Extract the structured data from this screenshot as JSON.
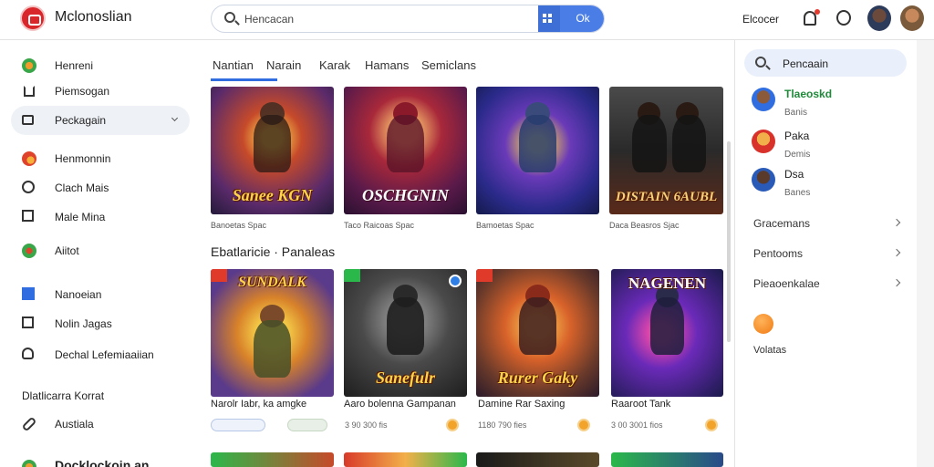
{
  "header": {
    "app_name": "Mclonoslian",
    "search_placeholder": "Hencacan",
    "search_button_label": "Ok",
    "right_text": "Elcocer",
    "bell_dot_color": "#e43b2f"
  },
  "sidebar": {
    "items": [
      {
        "label": "Henreni",
        "icon": "globe-icon"
      },
      {
        "label": "Piemsogan",
        "icon": "home-icon"
      },
      {
        "label": "Peckagain",
        "icon": "library-icon",
        "active": true
      },
      {
        "label": "Henmonnin",
        "icon": "flame-icon"
      },
      {
        "label": "Clach Mais",
        "icon": "clock-icon"
      },
      {
        "label": "Male Mina",
        "icon": "square-icon"
      },
      {
        "label": "Aiitot",
        "icon": "compass-icon"
      },
      {
        "label": "Nanoeian",
        "icon": "grid-icon"
      },
      {
        "label": "Nolin Jagas",
        "icon": "image-icon"
      },
      {
        "label": "Dechal Lefemiaaiian",
        "icon": "user-icon"
      },
      {
        "label": "Austiala",
        "icon": "link-icon"
      },
      {
        "label": "Docklockoin.an",
        "icon": "globe-icon"
      }
    ],
    "section_heading": "Dlatlicarra Korrat"
  },
  "tabs": [
    {
      "label": "Nantian",
      "active": true
    },
    {
      "label": "Narain"
    },
    {
      "label": "Karak"
    },
    {
      "label": "Hamans"
    },
    {
      "label": "Semiclans"
    }
  ],
  "row1": [
    {
      "title": "Sanee KGN",
      "caption": "Banoetas Spac"
    },
    {
      "title": "OSCHGNIN",
      "caption": "Taco Raicoas Spac"
    },
    {
      "title": "",
      "caption": "Bamoetas Spac"
    },
    {
      "title": "DISTAIN 6AUBL",
      "caption": "Daca Beasros Sjac"
    }
  ],
  "section_title": "Ebatlaricie · Panaleas",
  "row2": [
    {
      "title": "SUNDALK",
      "name": "Narolr Iabr, ka amgke",
      "meta": ""
    },
    {
      "title": "Sanefulr",
      "name": "Aaro bolenna Gampanan",
      "meta": "3 90 300 fis"
    },
    {
      "title": "Rurer Gaky",
      "name": "Damine Rar Saxing",
      "meta": "1180 790 fies"
    },
    {
      "title": "NAGENEN",
      "name": "Raaroot Tank",
      "meta": "3 00 3001 fios"
    }
  ],
  "right_panel": {
    "search_label": "Pencaain",
    "users": [
      {
        "name": "Tlaeoskd",
        "sub": "Banis"
      },
      {
        "name": "Paka",
        "sub": "Demis"
      },
      {
        "name": "Dsa",
        "sub": "Banes"
      }
    ],
    "rows": [
      "Gracemans",
      "Pentooms",
      "Pieaoenkalae"
    ],
    "footer": "Volatas"
  }
}
